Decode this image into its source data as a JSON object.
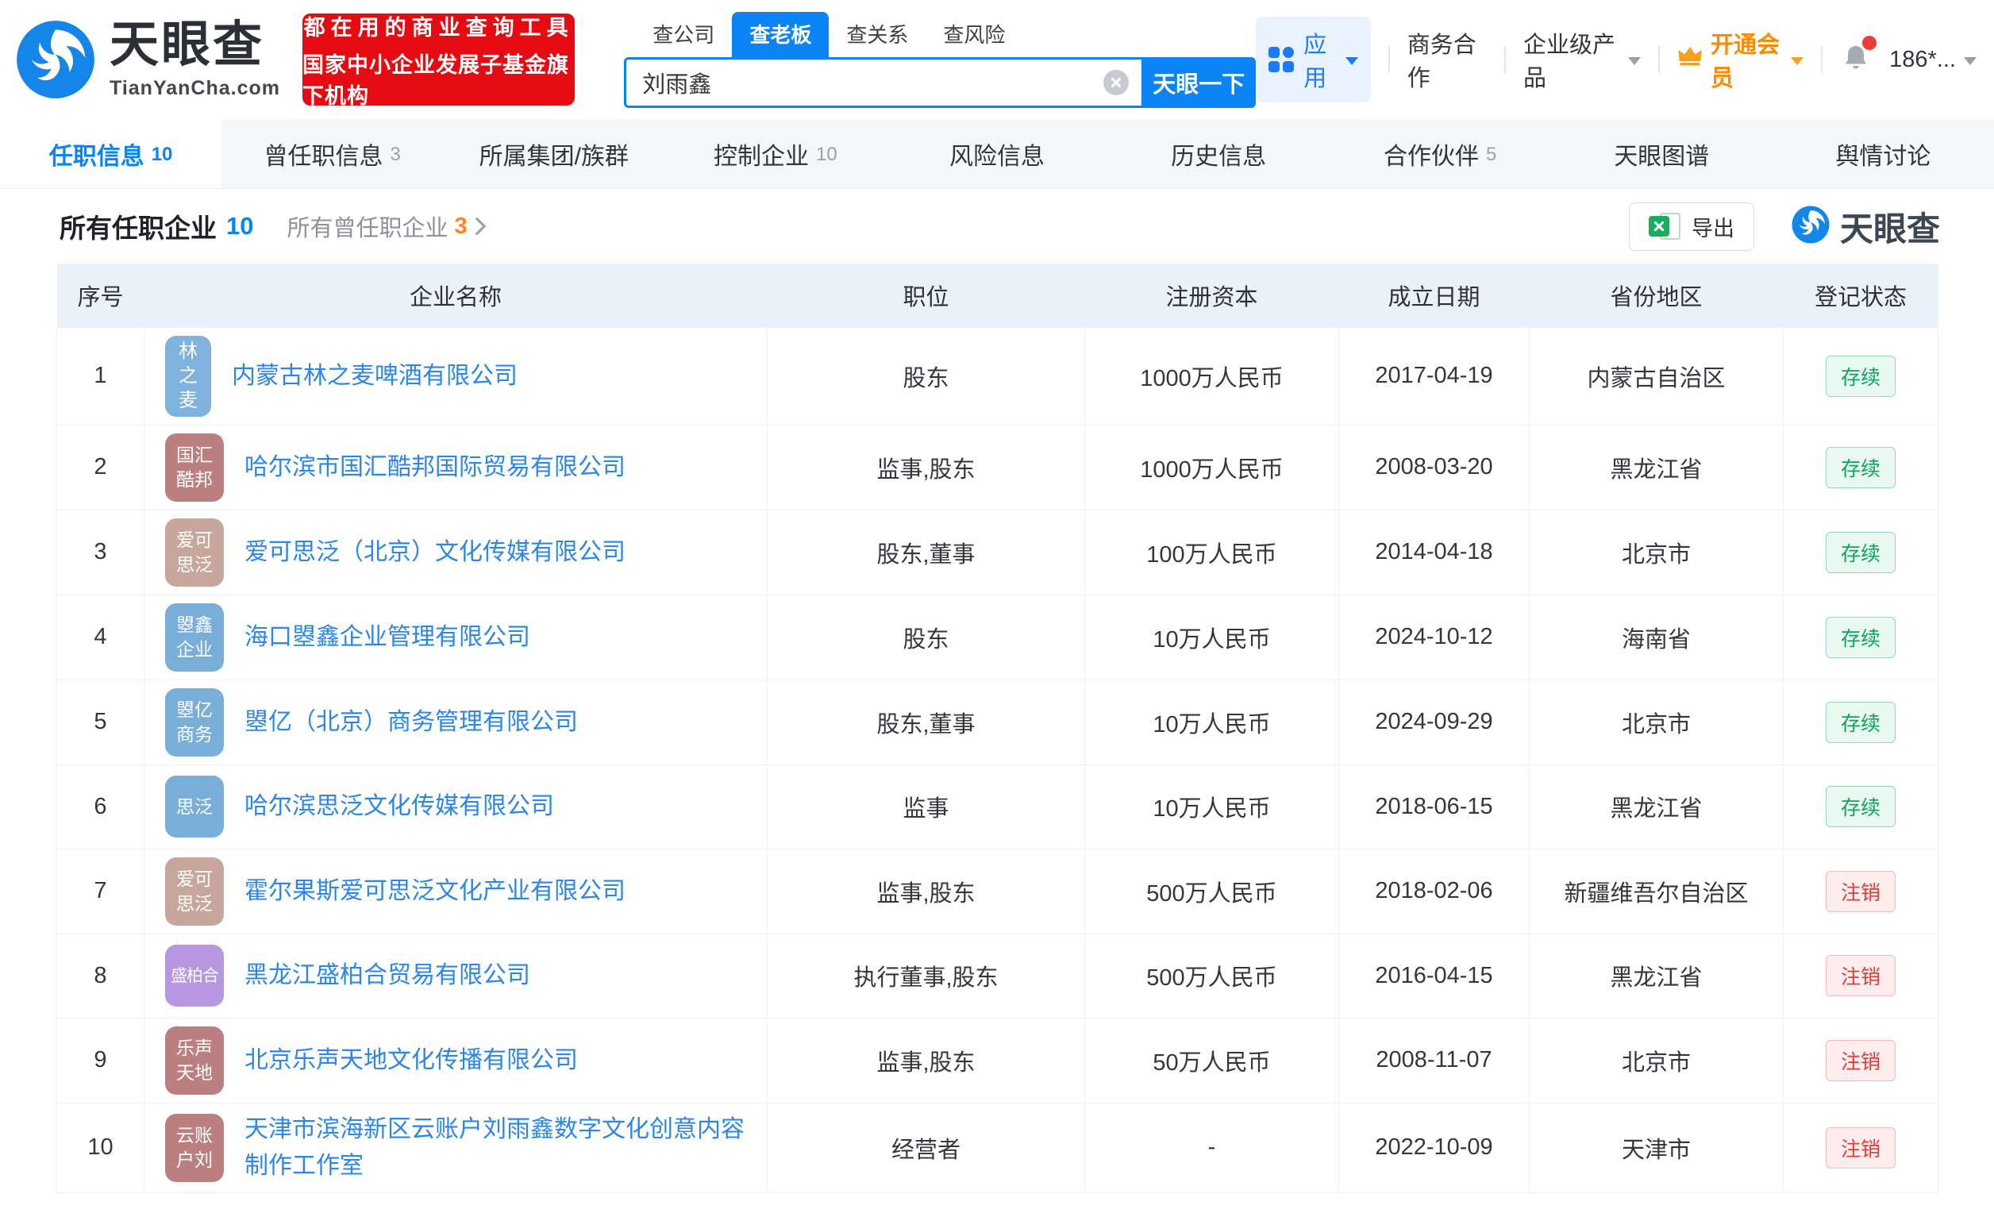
{
  "brand": {
    "name": "天眼查",
    "domain": "TianYanCha.com",
    "accent": "#0a84f5"
  },
  "banner": {
    "line1": "都在用的商业查询工具",
    "line2": "国家中小企业发展子基金旗下机构",
    "bg": "#e60b12"
  },
  "search": {
    "tabs": [
      {
        "label": "查公司",
        "active": false
      },
      {
        "label": "查老板",
        "active": true
      },
      {
        "label": "查关系",
        "active": false
      },
      {
        "label": "查风险",
        "active": false
      }
    ],
    "value": "刘雨鑫",
    "submit_label": "天眼一下"
  },
  "nav": {
    "apps_label": "应用",
    "biz_label": "商务合作",
    "enterprise_label": "企业级产品",
    "vip_label": "开通会员",
    "vip_color": "#ff8a00",
    "user_label": "186*..."
  },
  "page_tabs": [
    {
      "label": "任职信息",
      "count": "10",
      "active": true
    },
    {
      "label": "曾任职信息",
      "count": "3",
      "active": false
    },
    {
      "label": "所属集团/族群",
      "count": "",
      "active": false
    },
    {
      "label": "控制企业",
      "count": "10",
      "active": false
    },
    {
      "label": "风险信息",
      "count": "",
      "active": false
    },
    {
      "label": "历史信息",
      "count": "",
      "active": false
    },
    {
      "label": "合作伙伴",
      "count": "5",
      "active": false
    },
    {
      "label": "天眼图谱",
      "count": "",
      "active": false
    },
    {
      "label": "舆情讨论",
      "count": "",
      "active": false
    }
  ],
  "section": {
    "title": "所有任职企业",
    "title_count": "10",
    "sub_title": "所有曾任职企业",
    "sub_count": "3",
    "export_label": "导出",
    "watermark": "天眼查"
  },
  "table": {
    "headers": [
      "序号",
      "企业名称",
      "职位",
      "注册资本",
      "成立日期",
      "省份地区",
      "登记状态"
    ],
    "status_styles": {
      "存续": {
        "color": "#0fa35f",
        "bg": "#e9f8f0",
        "border": "#92dab7"
      },
      "注销": {
        "color": "#e03c3a",
        "bg": "#fdeded",
        "border": "#f4bcbc"
      }
    },
    "rows": [
      {
        "no": "1",
        "logo_lines": [
          "林",
          "之",
          "麦"
        ],
        "logo_color": "#7fb2dc",
        "name": "内蒙古林之麦啤酒有限公司",
        "position": "股东",
        "capital": "1000万人民币",
        "date": "2017-04-19",
        "region": "内蒙古自治区",
        "status": "存续"
      },
      {
        "no": "2",
        "logo_lines": [
          "国汇",
          "酷邦"
        ],
        "logo_color": "#bb7f7f",
        "name": "哈尔滨市国汇酷邦国际贸易有限公司",
        "position": "监事,股东",
        "capital": "1000万人民币",
        "date": "2008-03-20",
        "region": "黑龙江省",
        "status": "存续"
      },
      {
        "no": "3",
        "logo_lines": [
          "爱可",
          "思泛"
        ],
        "logo_color": "#c7a69b",
        "name": "爱可思泛（北京）文化传媒有限公司",
        "position": "股东,董事",
        "capital": "100万人民币",
        "date": "2014-04-18",
        "region": "北京市",
        "status": "存续"
      },
      {
        "no": "4",
        "logo_lines": [
          "曌鑫",
          "企业"
        ],
        "logo_color": "#79aed8",
        "name": "海口曌鑫企业管理有限公司",
        "position": "股东",
        "capital": "10万人民币",
        "date": "2024-10-12",
        "region": "海南省",
        "status": "存续"
      },
      {
        "no": "5",
        "logo_lines": [
          "曌亿",
          "商务"
        ],
        "logo_color": "#79aed8",
        "name": "曌亿（北京）商务管理有限公司",
        "position": "股东,董事",
        "capital": "10万人民币",
        "date": "2024-09-29",
        "region": "北京市",
        "status": "存续"
      },
      {
        "no": "6",
        "logo_lines": [
          "思泛"
        ],
        "logo_color": "#79aed8",
        "name": "哈尔滨思泛文化传媒有限公司",
        "position": "监事",
        "capital": "10万人民币",
        "date": "2018-06-15",
        "region": "黑龙江省",
        "status": "存续"
      },
      {
        "no": "7",
        "logo_lines": [
          "爱可",
          "思泛"
        ],
        "logo_color": "#c7a69b",
        "name": "霍尔果斯爱可思泛文化产业有限公司",
        "position": "监事,股东",
        "capital": "500万人民币",
        "date": "2018-02-06",
        "region": "新疆维吾尔自治区",
        "status": "注销"
      },
      {
        "no": "8",
        "logo_lines": [
          "盛柏合"
        ],
        "logo_color": "#b697e0",
        "name": "黑龙江盛柏合贸易有限公司",
        "position": "执行董事,股东",
        "capital": "500万人民币",
        "date": "2016-04-15",
        "region": "黑龙江省",
        "status": "注销"
      },
      {
        "no": "9",
        "logo_lines": [
          "乐声",
          "天地"
        ],
        "logo_color": "#bb7f7f",
        "name": "北京乐声天地文化传播有限公司",
        "position": "监事,股东",
        "capital": "50万人民币",
        "date": "2008-11-07",
        "region": "北京市",
        "status": "注销"
      },
      {
        "no": "10",
        "logo_lines": [
          "云账",
          "户刘"
        ],
        "logo_color": "#bb7f7f",
        "name": "天津市滨海新区云账户刘雨鑫数字文化创意内容制作工作室",
        "position": "经营者",
        "capital": "-",
        "date": "2022-10-09",
        "region": "天津市",
        "status": "注销"
      }
    ]
  }
}
